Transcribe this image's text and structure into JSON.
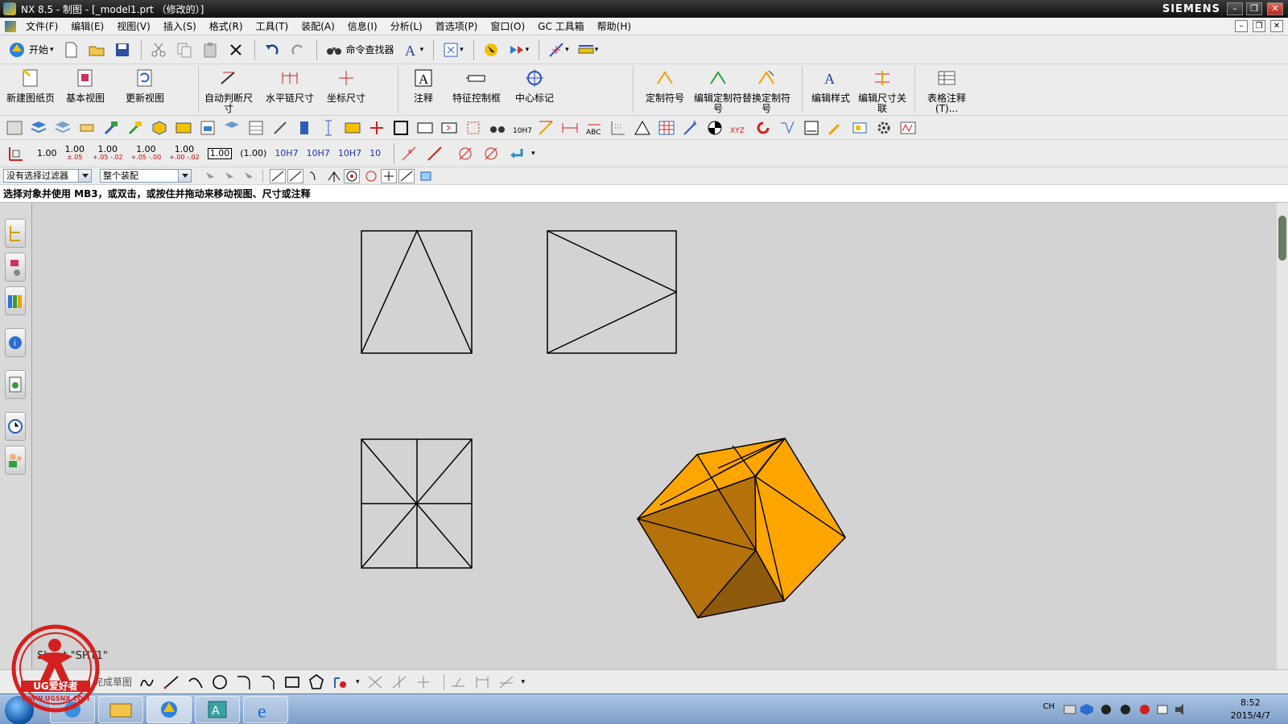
{
  "window": {
    "title": "NX 8.5 - 制图 - [_model1.prt （修改的）]",
    "brand": "SIEMENS"
  },
  "menu": {
    "items": [
      "文件(F)",
      "编辑(E)",
      "视图(V)",
      "插入(S)",
      "格式(R)",
      "工具(T)",
      "装配(A)",
      "信息(I)",
      "分析(L)",
      "首选项(P)",
      "窗口(O)",
      "GC 工具箱",
      "帮助(H)"
    ]
  },
  "toolbar1": {
    "start_label": "开始",
    "command_finder_label": "命令查找器"
  },
  "toolbar2": {
    "buttons": [
      "新建图纸页",
      "基本视图",
      "更新视图",
      "自动判断尺寸",
      "水平链尺寸",
      "坐标尺寸",
      "注释",
      "特征控制框",
      "中心标记",
      "定制符号",
      "编辑定制符号",
      "替换定制符号",
      "编辑样式",
      "编辑尺寸关联",
      "表格注释(T)..."
    ]
  },
  "toolbar4": {
    "dim_values": [
      "1.00",
      "1.00",
      "1.00",
      "1.00",
      "1.00",
      "1.00",
      "(1.00)",
      "10H7",
      "10H7",
      "10H7",
      "10"
    ],
    "tolerances": [
      "±.05",
      "+.05 -.02",
      "+.05 -.00",
      "+.00 -.02"
    ]
  },
  "selection": {
    "filter": "没有选择过滤器",
    "scope": "整个装配"
  },
  "cue_line": "选择对象并使用 MB3，或双击，或按住并拖动来移动视图、尺寸或注释",
  "sheet": {
    "label": "Sheet \"SHT1\""
  },
  "sketch": {
    "finish_label": "完成草图"
  },
  "taskbar": {
    "lang": "CH",
    "time": "8:52",
    "date": "2015/4/7"
  },
  "watermark": {
    "text": "UG爱好者",
    "url": "WWW.UGSNX.COM"
  },
  "colors": {
    "part_face_light": "#ffa500",
    "part_face_dark": "#b5720a",
    "viewport_bg": "#d3d3d3",
    "watermark_red": "#d42020"
  }
}
